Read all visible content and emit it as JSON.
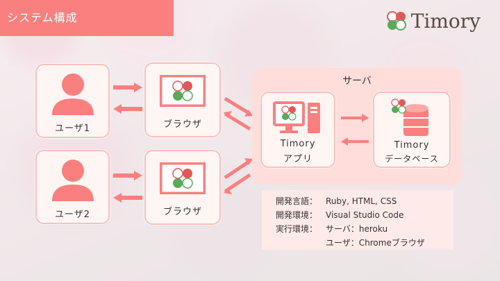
{
  "title": "システム構成",
  "logo": {
    "text": "Timory",
    "icon": "clover-logo-icon"
  },
  "users": [
    {
      "label": "ユーザ1",
      "icon": "user-icon"
    },
    {
      "label": "ユーザ2",
      "icon": "user-icon"
    }
  ],
  "browsers": [
    {
      "label": "ブラウザ",
      "icon": "browser-window-icon"
    },
    {
      "label": "ブラウザ",
      "icon": "browser-window-icon"
    }
  ],
  "server": {
    "title": "サーバ",
    "app": {
      "line1": "Timory",
      "line2": "アプリ",
      "icon": "computer-icon"
    },
    "db": {
      "line1": "Timory",
      "line2": "データベース",
      "icon": "database-icon"
    }
  },
  "info": {
    "dev_lang_key": "開発言語：",
    "dev_lang_val": "Ruby, HTML, CSS",
    "dev_env_key": "開発環境：",
    "dev_env_val": "Visual Studio Code",
    "run_env_key": "実行環境：",
    "run_env_val1": "サーバ：heroku",
    "run_env_val2": "ユーザ：Chromeブラウザ"
  },
  "colors": {
    "accent": "#f9807f",
    "card_border": "#f8c0bd",
    "green": "#5aa95a",
    "red": "#e2585a"
  }
}
